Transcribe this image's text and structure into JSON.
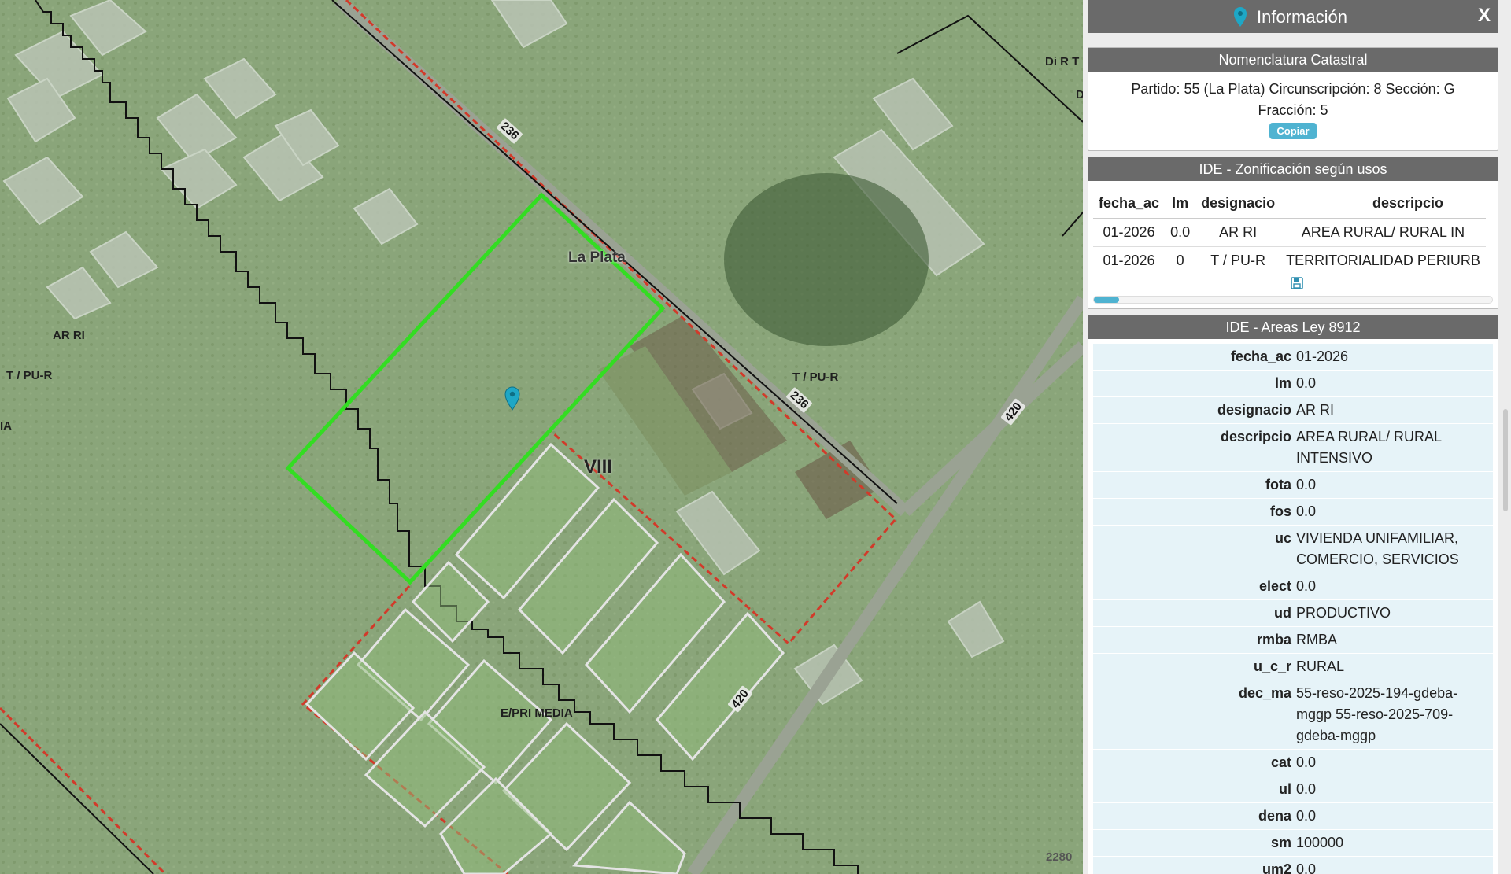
{
  "map": {
    "labels": {
      "ar_ri": "AR RI",
      "t_pu_r_left": "T / PU-R",
      "ia": "IA",
      "la_plata": "La Plata",
      "viii": "VIII",
      "t_pu_r_right": "T / PU-R",
      "e_pri_media": "E/PRI MEDIA",
      "di_r": "Di R T",
      "d": "D",
      "scale_partial": "2280"
    },
    "road_labels": {
      "r236_top": "236",
      "r236_mid": "236",
      "r420_right": "420",
      "r420_bottom": "420"
    },
    "colors": {
      "parcel_outline": "#33dd22",
      "marker": "#1ea7c6",
      "zone_dashed": "#d23a2a"
    }
  },
  "panel": {
    "title": "Información",
    "close_label": "X",
    "nomenclatura": {
      "header": "Nomenclatura Catastral",
      "line1": "Partido: 55 (La Plata) Circunscripción: 8 Sección: G",
      "line2": "Fracción: 5",
      "copy_label": "Copiar"
    },
    "zonificacion": {
      "header": "IDE - Zonificación según usos",
      "columns": [
        "fecha_ac",
        "lm",
        "designacio",
        "descripcio"
      ],
      "rows": [
        [
          "01-2026",
          "0.0",
          "AR RI",
          "AREA RURAL/ RURAL IN"
        ],
        [
          "01-2026",
          "0",
          "T / PU-R",
          "TERRITORIALIDAD PERIURB"
        ]
      ]
    },
    "areas": {
      "header": "IDE - Areas Ley 8912",
      "rows": [
        {
          "key": "fecha_ac",
          "value": "01-2026"
        },
        {
          "key": "lm",
          "value": "0.0"
        },
        {
          "key": "designacio",
          "value": "AR RI"
        },
        {
          "key": "descripcio",
          "value": "AREA RURAL/ RURAL INTENSIVO"
        },
        {
          "key": "fota",
          "value": "0.0"
        },
        {
          "key": "fos",
          "value": "0.0"
        },
        {
          "key": "uc",
          "value": "VIVIENDA UNIFAMILIAR, COMERCIO, SERVICIOS"
        },
        {
          "key": "elect",
          "value": "0.0"
        },
        {
          "key": "ud",
          "value": "PRODUCTIVO"
        },
        {
          "key": "rmba",
          "value": "RMBA"
        },
        {
          "key": "u_c_r",
          "value": "RURAL"
        },
        {
          "key": "dec_ma",
          "value": "55-reso-2025-194-gdeba-mggp 55-reso-2025-709-gdeba-mggp"
        },
        {
          "key": "cat",
          "value": "0.0"
        },
        {
          "key": "ul",
          "value": "0.0"
        },
        {
          "key": "dena",
          "value": "0.0"
        },
        {
          "key": "sm",
          "value": "100000"
        },
        {
          "key": "um2",
          "value": "0.0"
        }
      ]
    }
  }
}
